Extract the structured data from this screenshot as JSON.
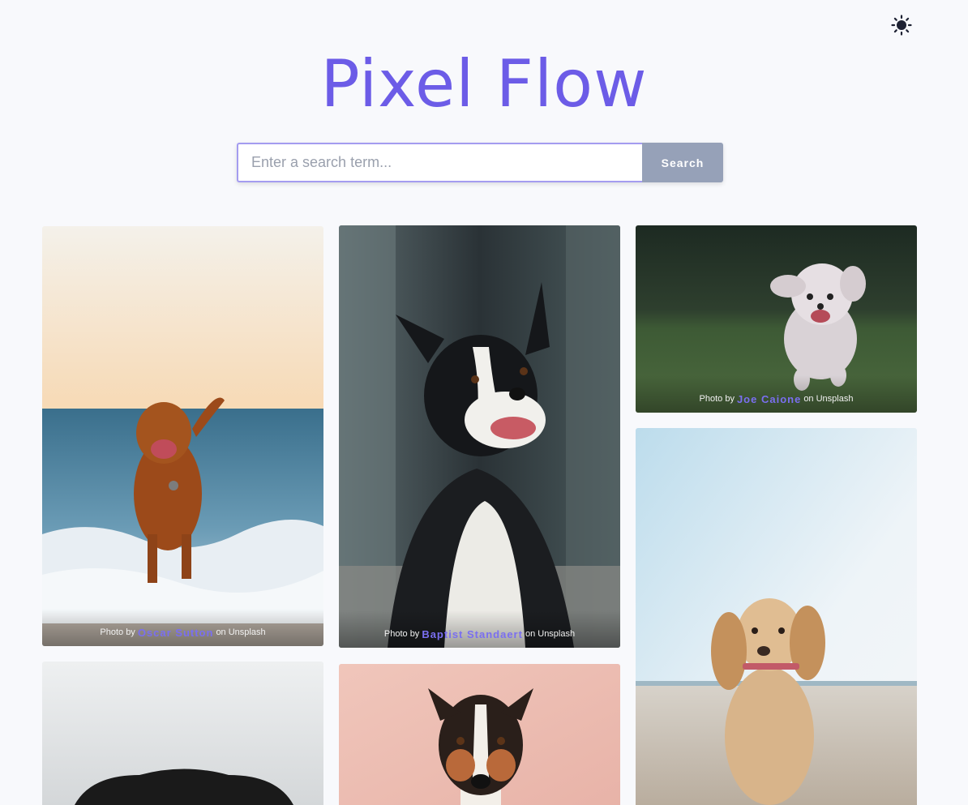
{
  "app": {
    "title": "Pixel Flow",
    "accent_color": "#6c5ce7"
  },
  "theme_toggle": {
    "icon": "sun-icon"
  },
  "search": {
    "placeholder": "Enter a search term...",
    "value": "",
    "button_label": "Search"
  },
  "photos": [
    {
      "author": "Oscar Sutton",
      "prefix": "Photo by",
      "suffix": "on Unsplash",
      "subject": "dog running in sea waves"
    },
    {
      "author": "Baptist Standaert",
      "prefix": "Photo by",
      "suffix": "on Unsplash",
      "subject": "border collie smiling"
    },
    {
      "author": "Joe Caione",
      "prefix": "Photo by",
      "suffix": "on Unsplash",
      "subject": "white poodle running on grass"
    },
    {
      "author": "",
      "prefix": "",
      "suffix": "",
      "subject": "cocker spaniel puppy on beach"
    },
    {
      "author": "",
      "prefix": "",
      "suffix": "",
      "subject": "dark dog head on grey"
    },
    {
      "author": "",
      "prefix": "",
      "suffix": "",
      "subject": "jack russell on pink background"
    }
  ]
}
